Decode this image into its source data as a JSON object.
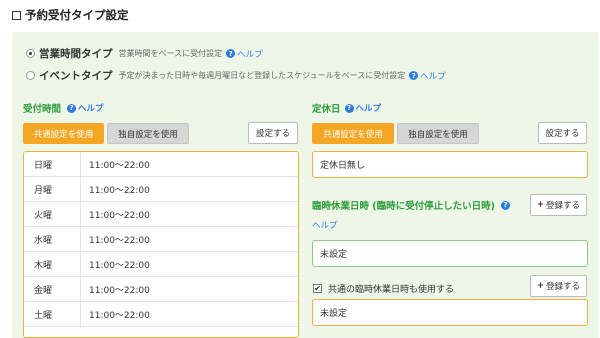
{
  "title": "予約受付タイプ設定",
  "reception_types": [
    {
      "label": "営業時間タイプ",
      "description": "営業時間をベースに受付設定",
      "help": "ヘルプ",
      "selected": true
    },
    {
      "label": "イベントタイプ",
      "description": "予定が決まった日時や毎週月曜日など登録したスケジュールをベースに受付設定",
      "help": "ヘルプ",
      "selected": false
    }
  ],
  "reception_hours": {
    "title": "受付時間",
    "help": "ヘルプ",
    "use_common_label": "共通設定を使用",
    "use_custom_label": "独自設定を使用",
    "settings_label": "設定する",
    "rows": [
      {
        "day": "日曜",
        "time": "11:00～22:00"
      },
      {
        "day": "月曜",
        "time": "11:00～22:00"
      },
      {
        "day": "火曜",
        "time": "11:00～22:00"
      },
      {
        "day": "水曜",
        "time": "11:00～22:00"
      },
      {
        "day": "木曜",
        "time": "11:00～22:00"
      },
      {
        "day": "金曜",
        "time": "11:00～22:00"
      },
      {
        "day": "土曜",
        "time": "11:00～22:00"
      }
    ]
  },
  "holidays": {
    "title": "定休日",
    "help": "ヘルプ",
    "use_common_label": "共通設定を使用",
    "use_custom_label": "独自設定を使用",
    "settings_label": "設定する",
    "value": "定休日無し"
  },
  "temporary_closure": {
    "title": "臨時休業日時 (臨時に受付停止したい日時)",
    "help": "ヘルプ",
    "register_label": "登録する",
    "value": "未設定",
    "common_checkbox_label": "共通の臨時休業日時も使用する",
    "common_checked": true,
    "common_register_label": "登録する",
    "common_value": "未設定"
  },
  "colors": {
    "accent_orange": "#f5a623",
    "section_green": "#2e9e3c",
    "link_blue": "#2c7be5",
    "panel_bg": "#eef6e8"
  }
}
